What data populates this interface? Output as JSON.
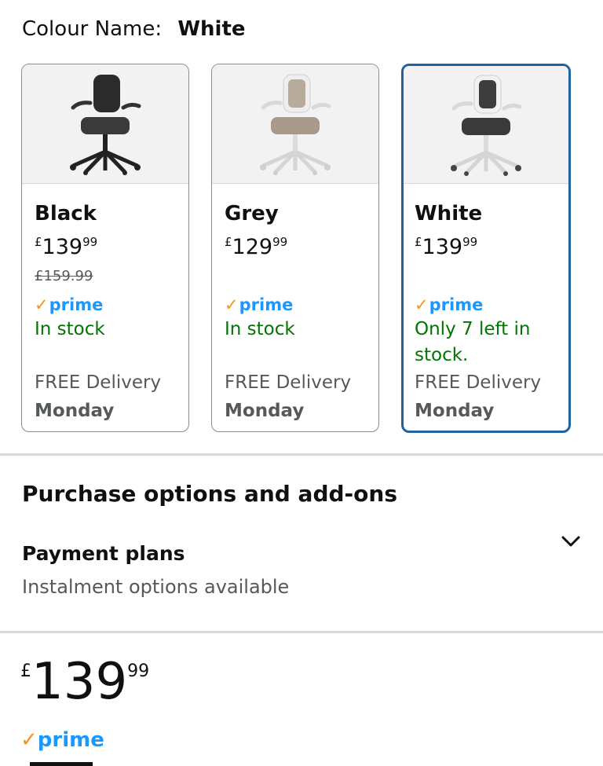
{
  "colour_selector": {
    "label": "Colour Name:",
    "selected": "White"
  },
  "variants": [
    {
      "name": "Black",
      "currency": "£",
      "price_whole": "139",
      "price_fraction": "99",
      "was_price": "£159.99",
      "prime": "prime",
      "stock": "In stock",
      "delivery": "FREE Delivery",
      "delivery_day": "Monday"
    },
    {
      "name": "Grey",
      "currency": "£",
      "price_whole": "129",
      "price_fraction": "99",
      "was_price": "",
      "prime": "prime",
      "stock": "In stock",
      "delivery": "FREE Delivery",
      "delivery_day": "Monday"
    },
    {
      "name": "White",
      "currency": "£",
      "price_whole": "139",
      "price_fraction": "99",
      "was_price": "",
      "prime": "prime",
      "stock": "Only 7 left in stock.",
      "delivery": "FREE Delivery",
      "delivery_day": "Monday"
    }
  ],
  "purchase_options": {
    "title": "Purchase options and add-ons",
    "payment_plans_title": "Payment plans",
    "payment_plans_subtitle": "Instalment options available"
  },
  "summary_price": {
    "currency": "£",
    "whole": "139",
    "fraction": "99"
  },
  "prime_badge": "prime",
  "colors": {
    "accent_selected": "#2162a1",
    "prime_blue": "#1a98ff",
    "prime_tick": "#f7921e",
    "in_stock": "#007600"
  },
  "icons": {
    "chevron": "chevron-down-icon",
    "chair": "office-chair-image"
  }
}
